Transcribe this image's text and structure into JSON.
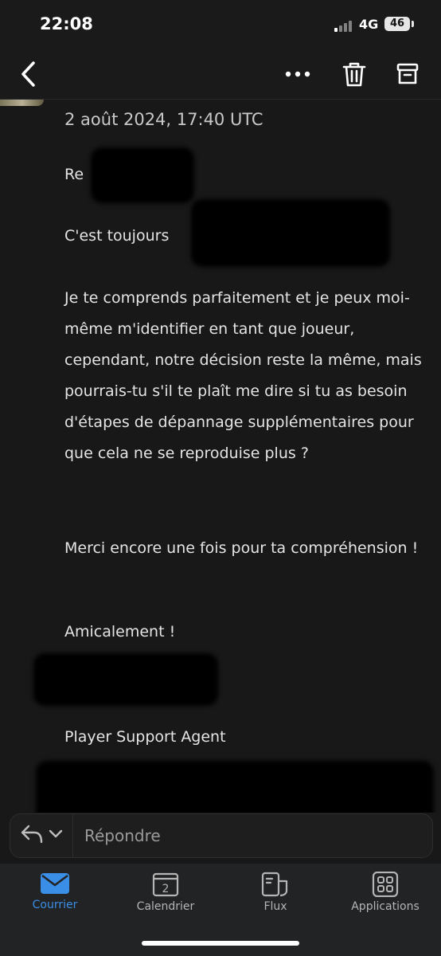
{
  "status_bar": {
    "time": "22:08",
    "network": "4G",
    "battery": "46"
  },
  "toolbar": {
    "back_icon": "chevron-left-icon",
    "more_icon": "more-horizontal-icon",
    "delete_icon": "trash-icon",
    "archive_icon": "archive-icon"
  },
  "email": {
    "date": "2 août 2024, 17:40 UTC",
    "greeting": "Re",
    "line1": "C'est toujours",
    "paragraph1": "Je te comprends parfaitement et je peux moi-même m'identifier en tant que joueur, cependant, notre décision reste la même, mais pourrais-tu s'il te plaît me dire si tu as besoin d'étapes de dépannage supplémentaires pour que cela ne se reproduise plus ?",
    "paragraph2": "Merci encore une fois pour ta compréhension !",
    "closing": "Amicalement !",
    "signature_role": "Player Support Agent"
  },
  "reply": {
    "placeholder": "Répondre"
  },
  "tabs": [
    {
      "label": "Courrier",
      "icon": "mail-icon",
      "active": true
    },
    {
      "label": "Calendrier",
      "icon": "calendar-icon",
      "day": "2"
    },
    {
      "label": "Flux",
      "icon": "feed-icon"
    },
    {
      "label": "Applications",
      "icon": "apps-grid-icon"
    }
  ],
  "colors": {
    "accent": "#3a8ee6",
    "background": "#181818"
  }
}
